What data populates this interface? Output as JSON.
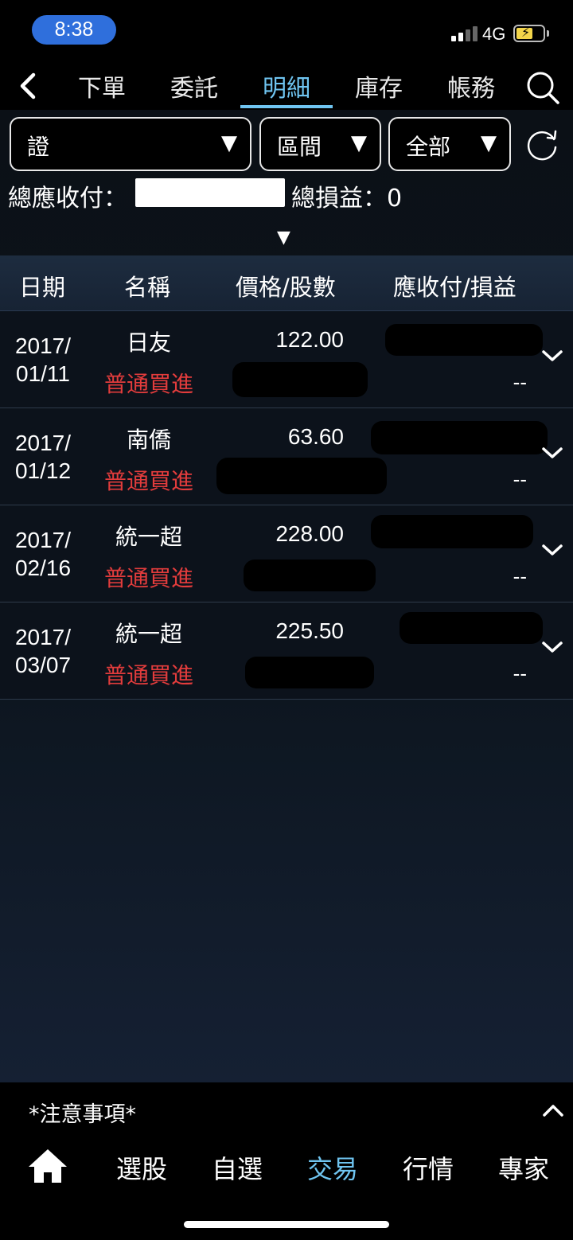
{
  "status_bar": {
    "time": "8:38",
    "network": "4G"
  },
  "top_nav": {
    "tabs": [
      {
        "label": "下單",
        "active": false
      },
      {
        "label": "委託",
        "active": false
      },
      {
        "label": "明細",
        "active": true
      },
      {
        "label": "庫存",
        "active": false
      },
      {
        "label": "帳務",
        "active": false
      }
    ]
  },
  "filters": {
    "account": {
      "label": "證",
      "arrow": "▼"
    },
    "range": {
      "label": "區間",
      "arrow": "▼"
    },
    "scope": {
      "label": "全部",
      "arrow": "▼"
    }
  },
  "summary": {
    "total_receivable_label": "總應收付：",
    "total_pl_label": "總損益：",
    "total_pl_value": "0",
    "expand_caret": "▼"
  },
  "table": {
    "headers": {
      "date": "日期",
      "name": "名稱",
      "price_shares": "價格/股數",
      "receivable_pl": "應收付/損益"
    },
    "rows": [
      {
        "date_year": "2017/",
        "date_md": "01/11",
        "name": "日友",
        "type": "普通買進",
        "price": "122.00",
        "pl": "--"
      },
      {
        "date_year": "2017/",
        "date_md": "01/12",
        "name": "南僑",
        "type": "普通買進",
        "price": "63.60",
        "pl": "--"
      },
      {
        "date_year": "2017/",
        "date_md": "02/16",
        "name": "統一超",
        "type": "普通買進",
        "price": "228.00",
        "pl": "--"
      },
      {
        "date_year": "2017/",
        "date_md": "03/07",
        "name": "統一超",
        "type": "普通買進",
        "price": "225.50",
        "pl": "--"
      }
    ]
  },
  "notice": {
    "label": "*注意事項*"
  },
  "bottom_nav": {
    "items": [
      {
        "label": "選股",
        "active": false
      },
      {
        "label": "自選",
        "active": false
      },
      {
        "label": "交易",
        "active": true
      },
      {
        "label": "行情",
        "active": false
      },
      {
        "label": "專家",
        "active": false
      }
    ]
  },
  "colors": {
    "accent": "#6fc4f0",
    "buy_red": "#e23c3c",
    "time_pill": "#2f6fdc",
    "battery": "#f3d54a"
  },
  "icons": [
    "back-icon",
    "search-icon",
    "refresh-icon",
    "chevron-down-icon",
    "chevron-up-icon",
    "home-icon",
    "signal-icon",
    "battery-icon"
  ]
}
